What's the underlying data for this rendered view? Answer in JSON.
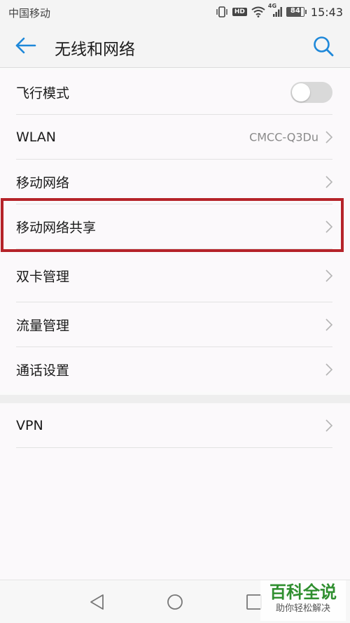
{
  "status_bar": {
    "carrier": "中国移动",
    "hd_badge": "HD",
    "network_type": "4G",
    "battery": "84",
    "battery_level": 0.84,
    "time": "15:43"
  },
  "header": {
    "back_icon": "arrow-left-icon",
    "title": "无线和网络",
    "search_icon": "search-icon",
    "accent_color": "#1e88d9"
  },
  "settings": {
    "group1": [
      {
        "label": "飞行模式",
        "control": "toggle",
        "enabled": false
      },
      {
        "label": "WLAN",
        "value": "CMCC-Q3Du",
        "control": "chevron"
      },
      {
        "label": "移动网络",
        "control": "chevron"
      },
      {
        "label": "移动网络共享",
        "control": "chevron",
        "highlighted": true
      },
      {
        "label": "双卡管理",
        "control": "chevron"
      },
      {
        "label": "流量管理",
        "control": "chevron"
      },
      {
        "label": "通话设置",
        "control": "chevron"
      }
    ],
    "group2": [
      {
        "label": "VPN",
        "control": "chevron"
      }
    ],
    "highlight_color": "#b52329"
  },
  "nav_bar": {
    "back": "triangle-back-icon",
    "home": "circle-home-icon",
    "recents": "square-recents-icon"
  },
  "watermark": {
    "title": "百科全说",
    "subtitle": "助你轻松解决"
  }
}
